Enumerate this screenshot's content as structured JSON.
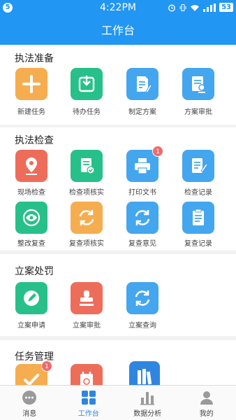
{
  "status_bar": {
    "sim": "5",
    "time": "4:22PM",
    "battery": "53"
  },
  "title": "工作台",
  "sections": [
    {
      "title": "执法准备",
      "items": [
        {
          "label": "新建任务",
          "icon": "plus-icon",
          "color": "#f6ad4f"
        },
        {
          "label": "待办任务",
          "icon": "download-tray-icon",
          "color": "#27c08b"
        },
        {
          "label": "制定方案",
          "icon": "document-edit-icon",
          "color": "#44a6ee"
        },
        {
          "label": "方案审批",
          "icon": "document-approve-icon",
          "color": "#44a6ee"
        }
      ]
    },
    {
      "title": "执法检查",
      "items": [
        {
          "label": "现场检查",
          "icon": "location-pin-icon",
          "color": "#ee6d5a"
        },
        {
          "label": "检查项核实",
          "icon": "document-check-icon",
          "color": "#27c08b"
        },
        {
          "label": "打印文书",
          "icon": "printer-icon",
          "color": "#44a6ee",
          "badge": "1"
        },
        {
          "label": "检查记录",
          "icon": "notebook-pen-icon",
          "color": "#44a6ee"
        },
        {
          "label": "整改复查",
          "icon": "eye-icon",
          "color": "#27c08b"
        },
        {
          "label": "复查项核实",
          "icon": "refresh-icon",
          "color": "#f6ad4f"
        },
        {
          "label": "复查意见",
          "icon": "refresh-icon",
          "color": "#44a6ee"
        },
        {
          "label": "复查记录",
          "icon": "clipboard-icon",
          "color": "#44a6ee"
        }
      ]
    },
    {
      "title": "立案处罚",
      "items": [
        {
          "label": "立案申请",
          "icon": "pen-circle-icon",
          "color": "#27c08b"
        },
        {
          "label": "立案审批",
          "icon": "stamp-icon",
          "color": "#ee6d5a"
        },
        {
          "label": "立案查询",
          "icon": "refresh-icon",
          "color": "#44a6ee"
        }
      ]
    },
    {
      "title": "任务管理",
      "items": [
        {
          "label": "",
          "icon": "checkmark-icon",
          "color": "#f6ad4f",
          "badge": "1"
        },
        {
          "label": "",
          "icon": "calendar-clock-icon",
          "color": "#ee6d5a"
        },
        {
          "label": "",
          "icon": "books-icon",
          "color": "#2f86e0"
        }
      ]
    }
  ],
  "tabs": [
    {
      "label": "消息",
      "icon": "chat-bubble-icon",
      "active": false
    },
    {
      "label": "工作台",
      "icon": "grid-icon",
      "active": true
    },
    {
      "label": "数据分析",
      "icon": "bar-chart-icon",
      "active": false
    },
    {
      "label": "我的",
      "icon": "person-icon",
      "active": false
    }
  ]
}
